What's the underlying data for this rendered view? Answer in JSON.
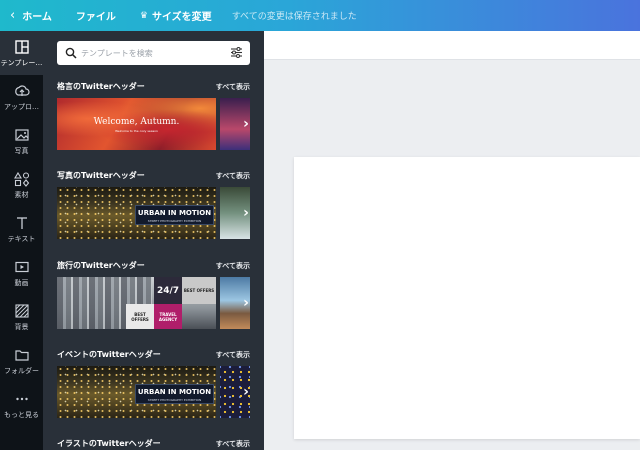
{
  "topbar": {
    "home_label": "ホーム",
    "file_label": "ファイル",
    "resize_label": "サイズを変更",
    "saved_status": "すべての変更は保存されました"
  },
  "rail": {
    "items": [
      {
        "label": "テンプレー…",
        "icon": "template-icon"
      },
      {
        "label": "アップロ…",
        "icon": "upload-icon"
      },
      {
        "label": "写真",
        "icon": "photo-icon"
      },
      {
        "label": "素材",
        "icon": "elements-icon"
      },
      {
        "label": "テキスト",
        "icon": "text-icon"
      },
      {
        "label": "動画",
        "icon": "video-icon"
      },
      {
        "label": "背景",
        "icon": "background-icon"
      },
      {
        "label": "フォルダー",
        "icon": "folder-icon"
      },
      {
        "label": "もっと見る",
        "icon": "more-icon"
      }
    ]
  },
  "search": {
    "placeholder": "テンプレートを検索"
  },
  "sections": [
    {
      "title": "格言のTwitterヘッダー",
      "show_all": "すべて表示",
      "thumb_title": "Welcome, Autumn.",
      "thumb_sub": "Welcome to the cozy season"
    },
    {
      "title": "写真のTwitterヘッダー",
      "show_all": "すべて表示",
      "thumb_title": "URBAN IN MOTION",
      "thumb_sub": "STREET PHOTOGRAPHY EXHIBITION"
    },
    {
      "title": "旅行のTwitterヘッダー",
      "show_all": "すべて表示",
      "thumb_title": "24/7",
      "best1": "BEST OFFERS",
      "best2": "BEST OFFERS",
      "travel": "TRAVEL AGENCY"
    },
    {
      "title": "イベントのTwitterヘッダー",
      "show_all": "すべて表示",
      "thumb_title": "URBAN IN MOTION",
      "thumb_sub": "STREET PHOTOGRAPHY EXHIBITION"
    },
    {
      "title": "イラストのTwitterヘッダー",
      "show_all": "すべて表示"
    }
  ],
  "colors": {
    "topbar_start": "#1fb9cc",
    "topbar_end": "#4a73dd",
    "rail_bg": "#0e1318",
    "panel_bg": "#293039"
  }
}
